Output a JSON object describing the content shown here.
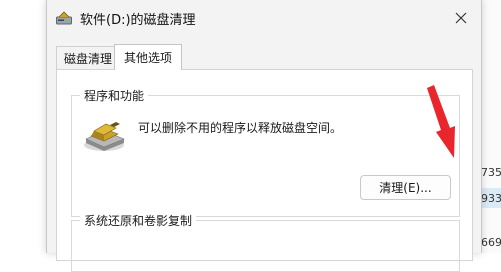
{
  "background_app": {
    "numbers": [
      ",735",
      ",933",
      ",669"
    ]
  },
  "dialog": {
    "title": "软件(D:)的磁盘清理",
    "title_icon": "disk-cleanup-icon",
    "close_icon": "close-icon",
    "tabs": [
      {
        "label": "磁盘清理",
        "selected": false
      },
      {
        "label": "其他选项",
        "selected": true
      }
    ],
    "programs_group": {
      "label": "程序和功能",
      "icon": "programs-features-icon",
      "description": "可以删除不用的程序以释放磁盘空间。",
      "button_label": "清理(E)..."
    },
    "restore_group": {
      "label": "系统还原和卷影复制"
    }
  },
  "annotation": {
    "arrow_color": "#e8262b"
  }
}
